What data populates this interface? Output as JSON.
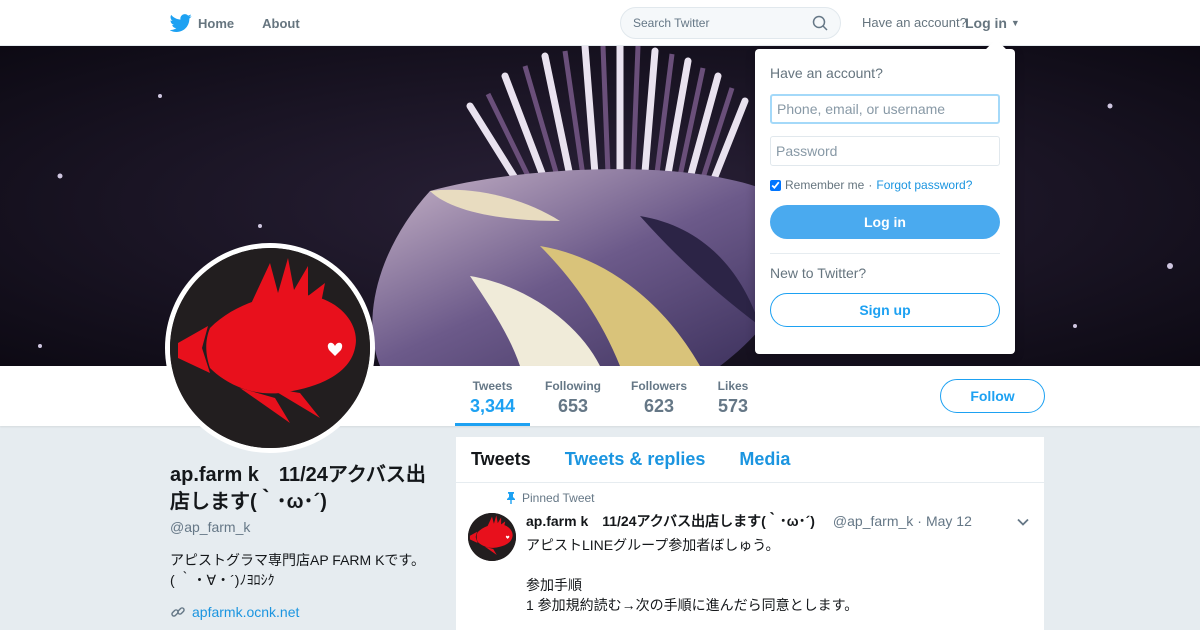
{
  "nav": {
    "home_label": "Home",
    "about_label": "About",
    "search_placeholder": "Search Twitter",
    "have_account_text": "Have an account?",
    "login_label": "Log in"
  },
  "profile_nav": {
    "stats": [
      {
        "label": "Tweets",
        "value": "3,344"
      },
      {
        "label": "Following",
        "value": "653"
      },
      {
        "label": "Followers",
        "value": "623"
      },
      {
        "label": "Likes",
        "value": "573"
      }
    ],
    "follow_label": "Follow"
  },
  "profile": {
    "name": "ap.farm k　11/24アクバス出店します(｀･ω･´)",
    "handle": "@ap_farm_k",
    "bio_line1": "アピストグラマ専門店AP FARM Kです。",
    "bio_line2": "( ｀・∀・´)ﾉﾖﾛｼｸ",
    "link": "apfarmk.ocnk.net"
  },
  "timeline": {
    "tabs": [
      "Tweets",
      "Tweets & replies",
      "Media"
    ],
    "pinned_label": "Pinned Tweet",
    "tweet": {
      "name": "ap.farm k　11/24アクバス出店します(｀･ω･´)",
      "handle": "@ap_farm_k",
      "separator": "·",
      "date": "May 12",
      "lines": [
        "アピストLINEグループ参加者ぼしゅう。",
        "",
        "参加手順",
        "1 参加規約読む→次の手順に進んだら同意とします。"
      ]
    }
  },
  "login_dropdown": {
    "title": "Have an account?",
    "username_placeholder": "Phone, email, or username",
    "password_placeholder": "Password",
    "remember_label": "Remember me",
    "separator": "·",
    "forgot_label": "Forgot password?",
    "login_button": "Log in",
    "new_text": "New to Twitter?",
    "signup_button": "Sign up"
  },
  "colors": {
    "brand_blue": "#1da1f2",
    "link_blue": "#1b95e0",
    "avatar_fish_red": "#e8101c",
    "avatar_bg": "#221e1f"
  }
}
